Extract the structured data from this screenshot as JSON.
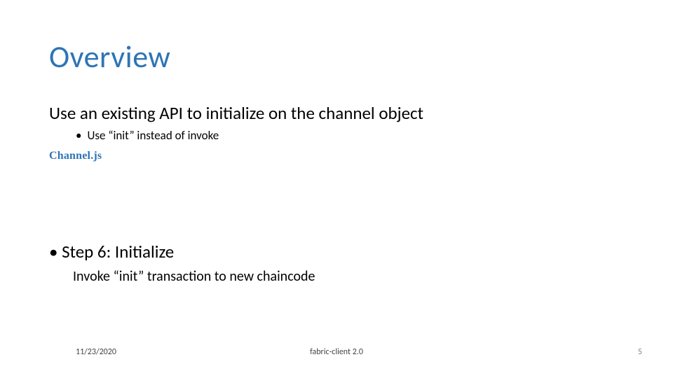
{
  "title": "Overview",
  "content": {
    "line1": "Use an existing API to initialize on the channel object",
    "sub1": "Use “init” instead of invoke"
  },
  "channel_label": "Channel.js",
  "step": {
    "title": "• Step 6: Initialize",
    "sub": "Invoke “init” transaction to new chaincode"
  },
  "footer": {
    "date": "11/23/2020",
    "center": "fabric-client 2.0",
    "page": "5"
  }
}
